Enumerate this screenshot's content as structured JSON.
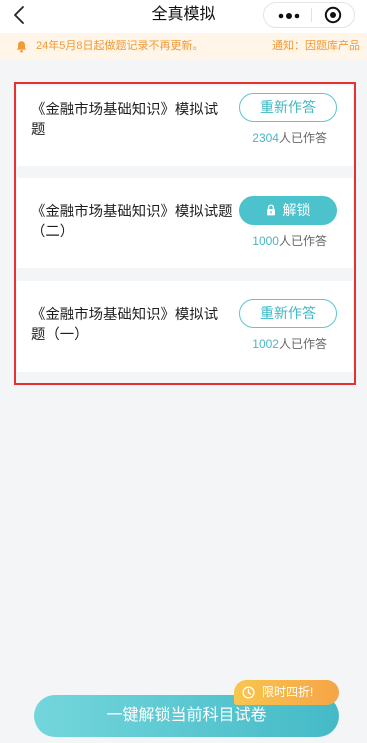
{
  "nav": {
    "title": "全真模拟",
    "back_icon": "back-arrow-icon",
    "more_icon": "more-dots-icon",
    "close_icon": "target-circle-icon"
  },
  "notice": {
    "icon": "bell-icon",
    "text": "24年5月8日起做题记录不再更新。",
    "text2": "通知：因题库产品"
  },
  "exams": [
    {
      "title": "《金融市场基础知识》模拟试题",
      "action": "重新作答",
      "count": "2304",
      "count_suffix": "人已作答"
    },
    {
      "title": "《金融市场基础知识》模拟试题（二）",
      "action": "解锁",
      "action_icon": "lock-icon",
      "count": "1000",
      "count_suffix": "人已作答"
    },
    {
      "title": "《金融市场基础知识》模拟试题（一）",
      "action": "重新作答",
      "count": "1002",
      "count_suffix": "人已作答"
    }
  ],
  "footer": {
    "unlock_all_label": "一键解锁当前科目试卷",
    "promo_badge": "限时四折!",
    "promo_icon": "clock-icon"
  },
  "colors": {
    "accent": "#4CC2CD",
    "notice_text": "#F29A35",
    "notice_bg": "#FFF5E8",
    "annotation": "#E5312F",
    "promo": "#F7B445"
  }
}
